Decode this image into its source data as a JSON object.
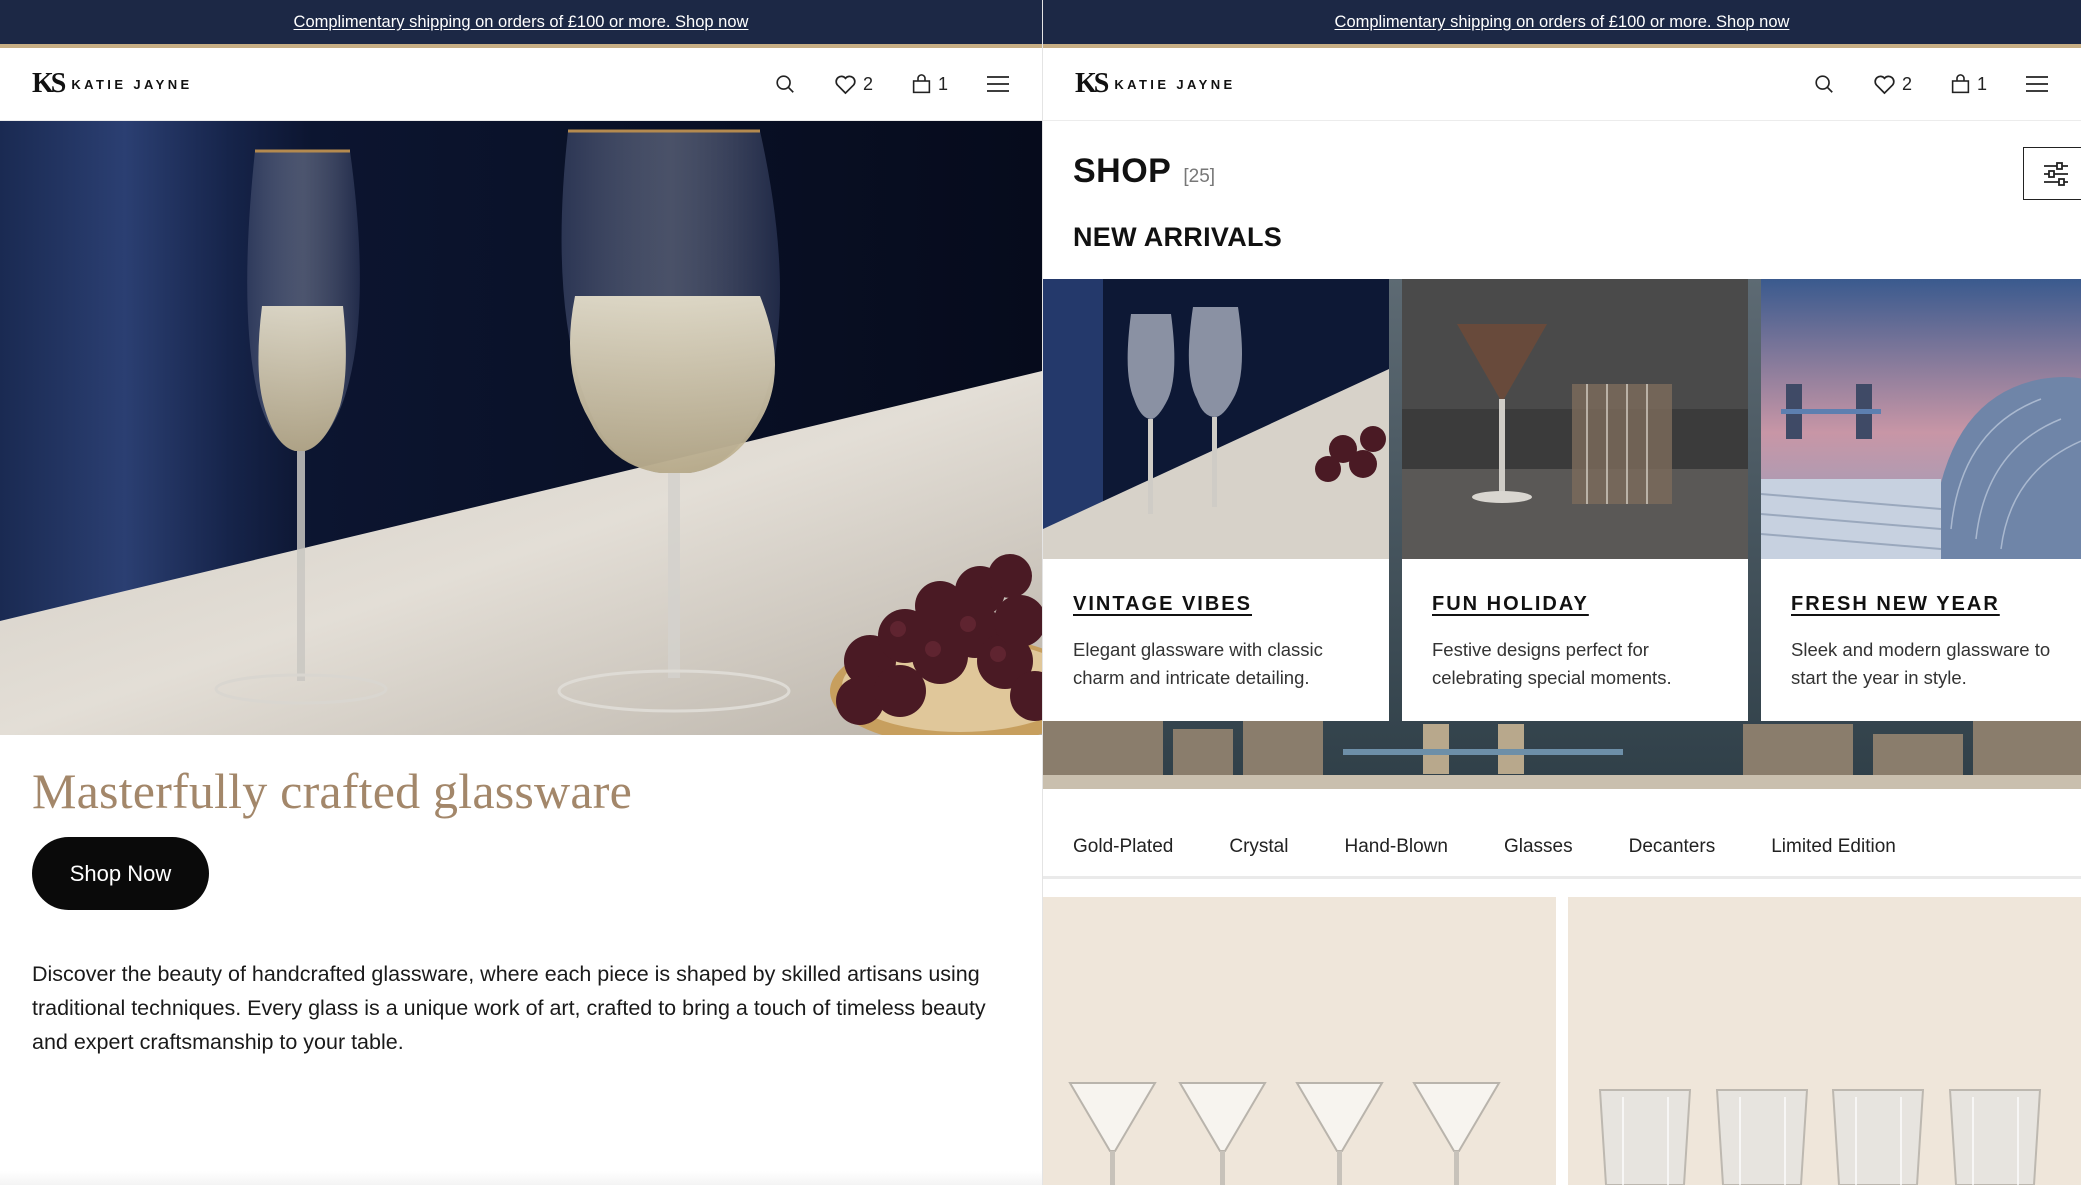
{
  "left": {
    "promo": {
      "text": "Complimentary shipping on orders of £100 or more. Shop now"
    },
    "header": {
      "logo_mark": "KS",
      "logo_text": "KATIE JAYNE",
      "wishlist_count": "2",
      "cart_count": "1"
    },
    "headline": "Masterfully crafted glassware",
    "cta_label": "Shop Now",
    "description": "Discover the beauty of handcrafted glassware, where each piece is shaped by skilled artisans using traditional techniques. Every glass is a unique work of art, crafted to bring a touch of timeless beauty and expert craftsmanship to your table."
  },
  "right": {
    "promo": {
      "text": "Complimentary shipping on orders of £100 or more. Shop now"
    },
    "header": {
      "logo_mark": "KS",
      "logo_text": "KATIE JAYNE",
      "wishlist_count": "2",
      "cart_count": "1"
    },
    "shop_title": "SHOP",
    "shop_count": "[25]",
    "section_title": "NEW ARRIVALS",
    "cards": [
      {
        "title": "VINTAGE VIBES",
        "description": "Elegant glassware with classic charm and intricate detailing."
      },
      {
        "title": "FUN HOLIDAY",
        "description": "Festive designs perfect for celebrating special moments."
      },
      {
        "title": "FRESH NEW YEAR",
        "description": "Sleek and modern glassware to start the year in style."
      }
    ],
    "tabs": [
      "Gold-Plated",
      "Crystal",
      "Hand-Blown",
      "Glasses",
      "Decanters",
      "Limited Edition"
    ]
  },
  "icons": [
    "search-icon",
    "heart-icon",
    "bag-icon",
    "menu-icon",
    "filter-icon"
  ],
  "colors": {
    "promo_bg": "#1c2845",
    "gold_accent": "#c7ae84",
    "headline": "#a3876a",
    "button_bg": "#0a0a0a"
  }
}
